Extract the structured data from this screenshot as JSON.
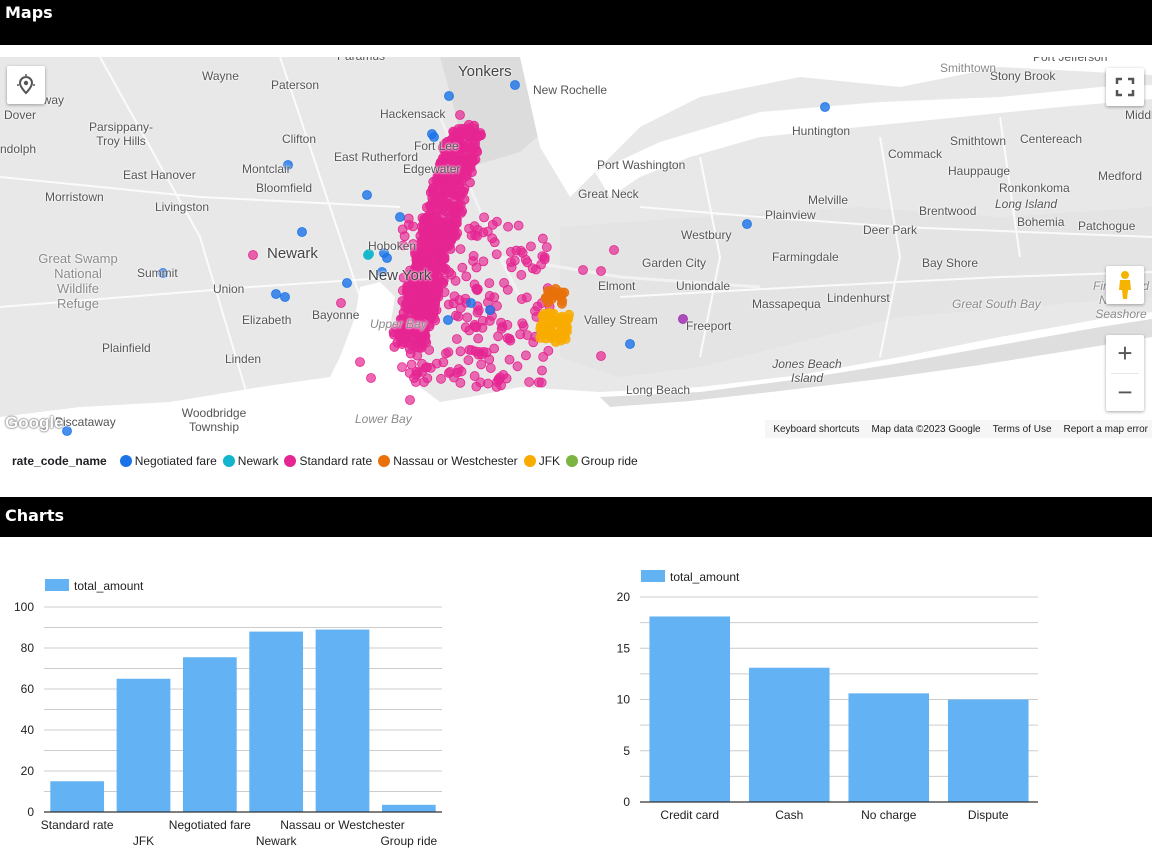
{
  "sections": {
    "maps_title": "Maps",
    "charts_title": "Charts"
  },
  "map": {
    "labels": [
      "Yonkers",
      "Paramus",
      "Wayne",
      "Paterson",
      "Hackensack",
      "New Rochelle",
      "Port Jefferson",
      "Stony Brook",
      "Smithtown",
      "Middle",
      "kaway",
      "Dover",
      "Parsippany-Troy Hills",
      "Clifton",
      "Fort Lee",
      "Huntington",
      "Smithtown",
      "Centereach",
      "ndolph",
      "East Rutherford",
      "Montclair",
      "Bloomfield",
      "Edgewater",
      "Port Washington",
      "Commack",
      "Hauppauge",
      "Medford",
      "East Hanover",
      "Great Neck",
      "Ronkonkoma",
      "Morristown",
      "Livingston",
      "Melville",
      "Long Island",
      "Plainview",
      "Brentwood",
      "Bohemia",
      "Patchogue",
      "Westbury",
      "Deer Park",
      "Newark",
      "Hoboken",
      "Farmingdale",
      "Great Swamp National Wildlife Refuge",
      "Summit",
      "New York",
      "Garden City",
      "Bay Shore",
      "Union",
      "Elmont",
      "Uniondale",
      "Massapequa",
      "Lindenhurst",
      "Great South Bay",
      "Fire Island National Seashore",
      "Elizabeth",
      "Bayonne",
      "Valley Stream",
      "Freeport",
      "Upper Bay",
      "Plainfield",
      "Linden",
      "Jones Beach Island",
      "Long Beach",
      "Woodbridge Township",
      "Piscataway",
      "Lower Bay"
    ],
    "attribution": [
      "Keyboard shortcuts",
      "Map data ©2023 Google",
      "Terms of Use",
      "Report a map error"
    ],
    "google_logo": "Google",
    "controls": {
      "zoom_in": "+",
      "zoom_out": "−"
    }
  },
  "legend": {
    "title": "rate_code_name",
    "items": [
      {
        "label": "Negotiated fare",
        "color": "#1a73e8"
      },
      {
        "label": "Newark",
        "color": "#12b5cb"
      },
      {
        "label": "Standard rate",
        "color": "#e52592"
      },
      {
        "label": "Nassau or Westchester",
        "color": "#e8710a"
      },
      {
        "label": "JFK",
        "color": "#f9ab00"
      },
      {
        "label": "Group ride",
        "color": "#7cb342"
      }
    ]
  },
  "chart_data": [
    {
      "type": "bar",
      "legend": "total_amount",
      "categories": [
        "Standard rate",
        "JFK",
        "Negotiated fare",
        "Newark",
        "Nassau or Westchester",
        "Group ride"
      ],
      "values": [
        15,
        65,
        75.5,
        88,
        89,
        3.5
      ],
      "ylim": [
        0,
        100
      ],
      "yticks": [
        0,
        20,
        40,
        60,
        80,
        100
      ],
      "gridlines": [
        10,
        20,
        30,
        40,
        50,
        60,
        70,
        80,
        90,
        100
      ],
      "bar_color": "#63b3f4"
    },
    {
      "type": "bar",
      "legend": "total_amount",
      "categories": [
        "Credit card",
        "Cash",
        "No charge",
        "Dispute"
      ],
      "values": [
        18.1,
        13.1,
        10.6,
        10
      ],
      "ylim": [
        0,
        20
      ],
      "yticks": [
        0,
        5,
        10,
        15,
        20
      ],
      "gridlines": [
        2.5,
        5,
        7.5,
        10,
        12.5,
        15,
        17.5,
        20
      ],
      "bar_color": "#63b3f4"
    }
  ]
}
